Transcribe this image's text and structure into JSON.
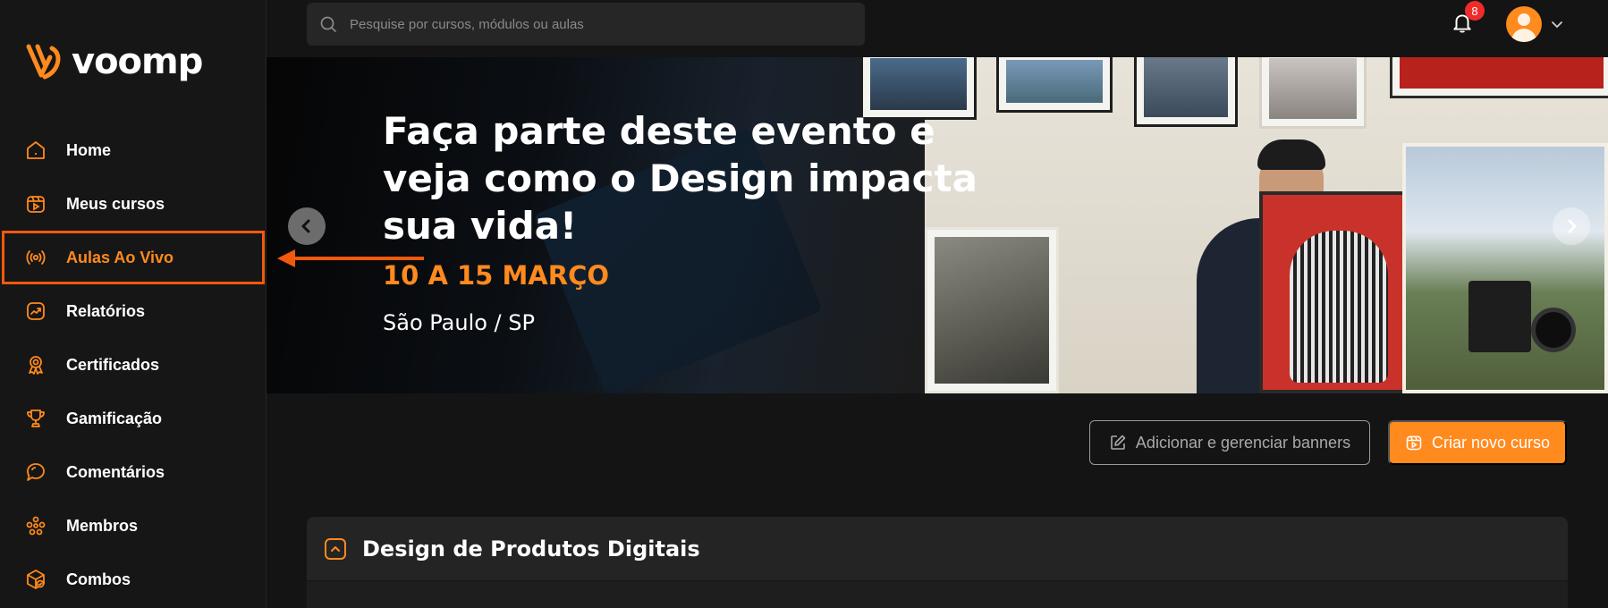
{
  "brand": {
    "name": "voomp",
    "accent": "#ff8a1e",
    "highlight": "#f1590d"
  },
  "search": {
    "placeholder": "Pesquise por cursos, módulos ou aulas"
  },
  "header": {
    "notifications_count": "8"
  },
  "sidebar": {
    "items": [
      {
        "label": "Home",
        "icon": "home-icon"
      },
      {
        "label": "Meus cursos",
        "icon": "course-player-icon"
      },
      {
        "label": "Aulas Ao Vivo",
        "icon": "broadcast-icon",
        "active": true
      },
      {
        "label": "Relatórios",
        "icon": "trending-chart-icon"
      },
      {
        "label": "Certificados",
        "icon": "award-badge-icon"
      },
      {
        "label": "Gamificação",
        "icon": "trophy-icon"
      },
      {
        "label": "Comentários",
        "icon": "chat-bubble-icon"
      },
      {
        "label": "Membros",
        "icon": "members-icon"
      },
      {
        "label": "Combos",
        "icon": "box-icon"
      }
    ]
  },
  "banner": {
    "title": "Faça parte deste evento e veja como o Design impacta sua vida!",
    "date": "10 A 15 MARÇO",
    "location": "São Paulo / SP"
  },
  "actions": {
    "manage_banners": "Adicionar e gerenciar banners",
    "new_course": "Criar novo curso"
  },
  "course": {
    "title": "Design de Produtos Digitais"
  }
}
